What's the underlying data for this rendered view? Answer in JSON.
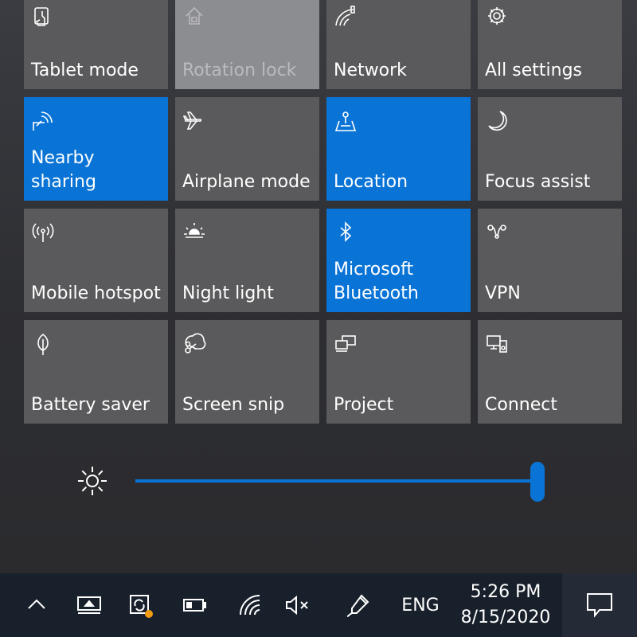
{
  "quick_actions": [
    {
      "label": "Tablet mode",
      "state": "off",
      "icon": "tablet-mode-icon"
    },
    {
      "label": "Rotation lock",
      "state": "disabled",
      "icon": "rotation-lock-icon"
    },
    {
      "label": "Network",
      "state": "off",
      "icon": "network-icon"
    },
    {
      "label": "All settings",
      "state": "off",
      "icon": "gear-icon"
    },
    {
      "label": "Nearby sharing",
      "state": "on",
      "icon": "nearby-sharing-icon"
    },
    {
      "label": "Airplane mode",
      "state": "off",
      "icon": "airplane-icon"
    },
    {
      "label": "Location",
      "state": "on",
      "icon": "location-icon"
    },
    {
      "label": "Focus assist",
      "state": "off",
      "icon": "moon-icon"
    },
    {
      "label": "Mobile hotspot",
      "state": "off",
      "icon": "hotspot-icon"
    },
    {
      "label": "Night light",
      "state": "off",
      "icon": "night-light-icon"
    },
    {
      "label": "Microsoft\nBluetooth",
      "state": "on",
      "icon": "bluetooth-icon"
    },
    {
      "label": "VPN",
      "state": "off",
      "icon": "vpn-icon"
    },
    {
      "label": "Battery saver",
      "state": "off",
      "icon": "battery-saver-icon"
    },
    {
      "label": "Screen snip",
      "state": "off",
      "icon": "scissors-icon"
    },
    {
      "label": "Project",
      "state": "off",
      "icon": "project-icon"
    },
    {
      "label": "Connect",
      "state": "off",
      "icon": "connect-icon"
    }
  ],
  "brightness": {
    "level_percent": 100,
    "icon": "brightness-icon"
  },
  "taskbar": {
    "language": "ENG",
    "time": "5:26 PM",
    "date": "8/15/2020"
  },
  "colors": {
    "accent": "#0a74d6",
    "tile": "#5a5a5c",
    "taskbar": "#18202b"
  }
}
